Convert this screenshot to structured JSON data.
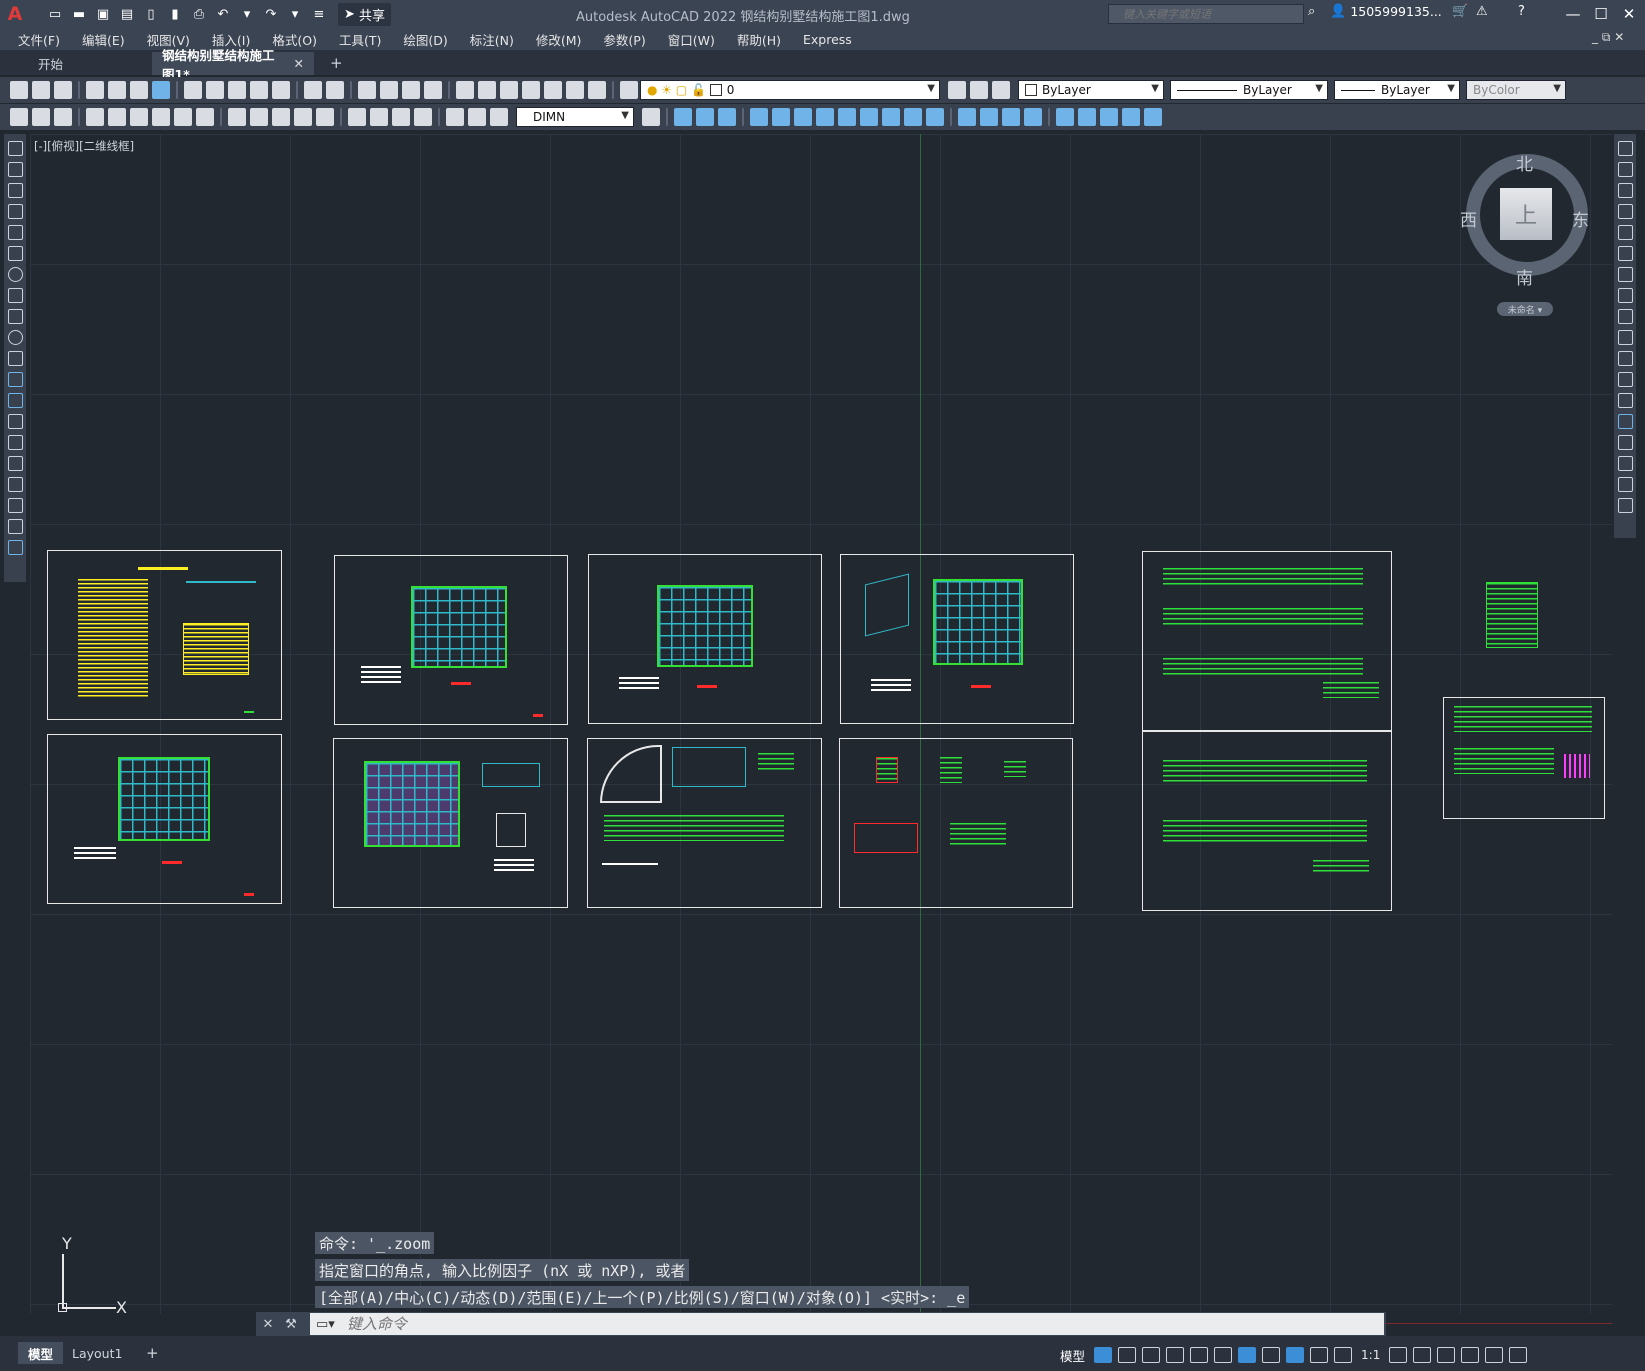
{
  "app": {
    "logo": "A",
    "title": "Autodesk AutoCAD 2022    钢结构别墅结构施工图1.dwg",
    "share_label": "共享",
    "search_placeholder": "键入关键字或短语",
    "user": "1505999135...",
    "minimize": "—",
    "maximize": "☐",
    "close": "✕"
  },
  "menu": [
    "文件(F)",
    "编辑(E)",
    "视图(V)",
    "插入(I)",
    "格式(O)",
    "工具(T)",
    "绘图(D)",
    "标注(N)",
    "修改(M)",
    "参数(P)",
    "窗口(W)",
    "帮助(H)",
    "Express"
  ],
  "tabs": {
    "start": "开始",
    "drawing": "钢结构别墅结构施工图1*",
    "close": "✕",
    "add": "+"
  },
  "toolbar": {
    "layer": "0",
    "color": "ByLayer",
    "linetype": "ByLayer",
    "lineweight": "ByLayer",
    "plotstyle": "ByColor",
    "dimstyle": "DIMN"
  },
  "viewport_label": "[-][俯视][二维线框]",
  "viewcube": {
    "north": "北",
    "south": "南",
    "east": "东",
    "west": "西",
    "face": "上",
    "wcs": "未命名 ▾"
  },
  "ucs": {
    "x": "X",
    "y": "Y"
  },
  "command": {
    "history": [
      "命令: '_.zoom",
      "指定窗口的角点, 输入比例因子 (nX 或 nXP), 或者",
      "[全部(A)/中心(C)/动态(D)/范围(E)/上一个(P)/比例(S)/窗口(W)/对象(O)] <实时>: _e"
    ],
    "placeholder": "键入命令",
    "close": "✕",
    "wrench": "🔧"
  },
  "status": {
    "model_tab": "模型",
    "layout1": "Layout1",
    "add": "+",
    "model_label": "模型",
    "scale": "1:1"
  },
  "colors": {
    "canvas": "#212830",
    "ui_dark": "#3b4453",
    "accent_green": "#2fe03a",
    "accent_cyan": "#2fb9c9",
    "accent_yellow": "#ffee22",
    "accent_red": "#ff2a2a"
  }
}
